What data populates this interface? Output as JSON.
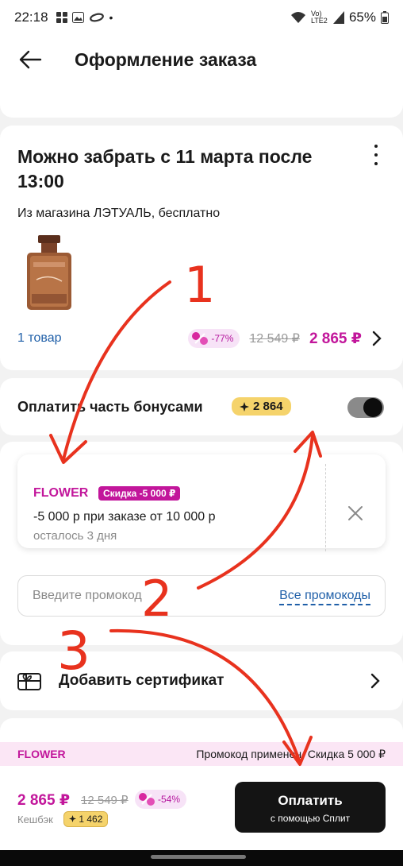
{
  "status_bar": {
    "time": "22:18",
    "dot": "•",
    "network": "Vo) LTE2",
    "battery": "65%"
  },
  "header": {
    "title": "Оформление заказа"
  },
  "pickup": {
    "title": "Можно забрать с 11 марта после 13:00",
    "subtitle": "Из магазина ЛЭТУАЛЬ, бесплатно",
    "items_link": "1 товар",
    "discount": "-77%",
    "old_price": "12 549 ₽",
    "new_price": "2 865 ₽"
  },
  "bonus": {
    "label": "Оплатить часть бонусами",
    "amount": "2 864",
    "enabled": true
  },
  "coupon": {
    "code": "FLOWER",
    "tag": "Скидка -5 000 ₽",
    "description": "-5 000 р при заказе от 10 000 р",
    "remaining": "осталось 3 дня"
  },
  "promo_input": {
    "placeholder": "Введите промокод",
    "all_link": "Все промокоды"
  },
  "certificate": {
    "label": "Добавить сертификат"
  },
  "applied": {
    "code": "FLOWER",
    "text": "Промокод применен. Скидка 5 000 ₽"
  },
  "bottom": {
    "price": "2 865 ₽",
    "old_price": "12 549 ₽",
    "discount": "-54%",
    "cashback_label": "Кешбэк",
    "cashback_amount": "1 462",
    "pay_label": "Оплатить",
    "pay_sub": "с помощью Сплит"
  },
  "annotations": {
    "one": "1",
    "two": "2",
    "three": "3"
  },
  "colors": {
    "accent": "#c2169b",
    "link": "#1f5fa8",
    "bonus": "#f5d36b",
    "annotation": "#e8321e"
  }
}
